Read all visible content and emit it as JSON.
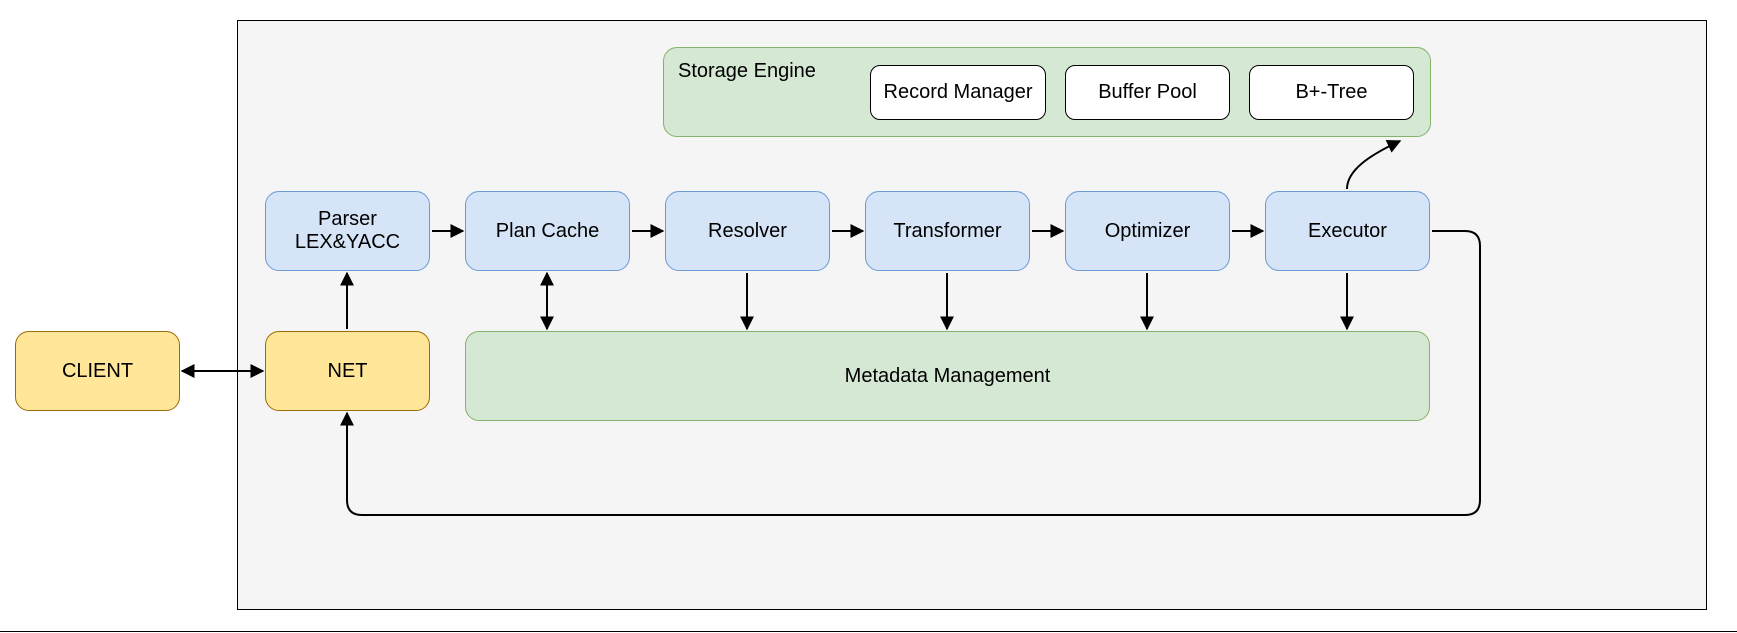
{
  "outer": {},
  "client": {
    "label": "CLIENT"
  },
  "net": {
    "label": "NET"
  },
  "parser": {
    "line1": "Parser",
    "line2": "LEX&YACC"
  },
  "plan_cache": {
    "label": "Plan Cache"
  },
  "resolver": {
    "label": "Resolver"
  },
  "transformer": {
    "label": "Transformer"
  },
  "optimizer": {
    "label": "Optimizer"
  },
  "executor": {
    "label": "Executor"
  },
  "storage_engine": {
    "label": "Storage Engine",
    "record_manager": "Record Manager",
    "buffer_pool": "Buffer Pool",
    "bplus_tree": "B+-Tree"
  },
  "metadata": {
    "label": "Metadata Management"
  }
}
